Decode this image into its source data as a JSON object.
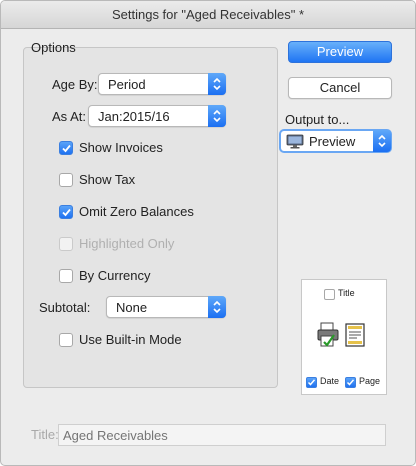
{
  "window": {
    "title": "Settings for \"Aged Receivables\" *"
  },
  "options": {
    "group_label": "Options",
    "age_by": {
      "label": "Age By:",
      "value": "Period"
    },
    "as_at": {
      "label": "As At:",
      "value": "Jan:2015/16"
    },
    "show_invoices": {
      "label": "Show Invoices",
      "checked": true
    },
    "show_tax": {
      "label": "Show Tax",
      "checked": false
    },
    "omit_zero": {
      "label": "Omit Zero Balances",
      "checked": true
    },
    "highlighted_only": {
      "label": "Highlighted Only",
      "checked": false,
      "enabled": false
    },
    "by_currency": {
      "label": "By Currency",
      "checked": false
    },
    "subtotal": {
      "label": "Subtotal:",
      "value": "None"
    },
    "builtin_mode": {
      "label": "Use Built-in Mode",
      "checked": false
    }
  },
  "buttons": {
    "preview": "Preview",
    "cancel": "Cancel"
  },
  "output": {
    "label": "Output to...",
    "value": "Preview",
    "icon": "monitor-icon"
  },
  "page_preview": {
    "title": {
      "label": "Title",
      "checked": false
    },
    "date": {
      "label": "Date",
      "checked": true
    },
    "page": {
      "label": "Page",
      "checked": true
    }
  },
  "title_field": {
    "label": "Title:",
    "placeholder": "Aged Receivables"
  },
  "colors": {
    "accent": "#1f74f3",
    "window_bg": "#ececec"
  }
}
